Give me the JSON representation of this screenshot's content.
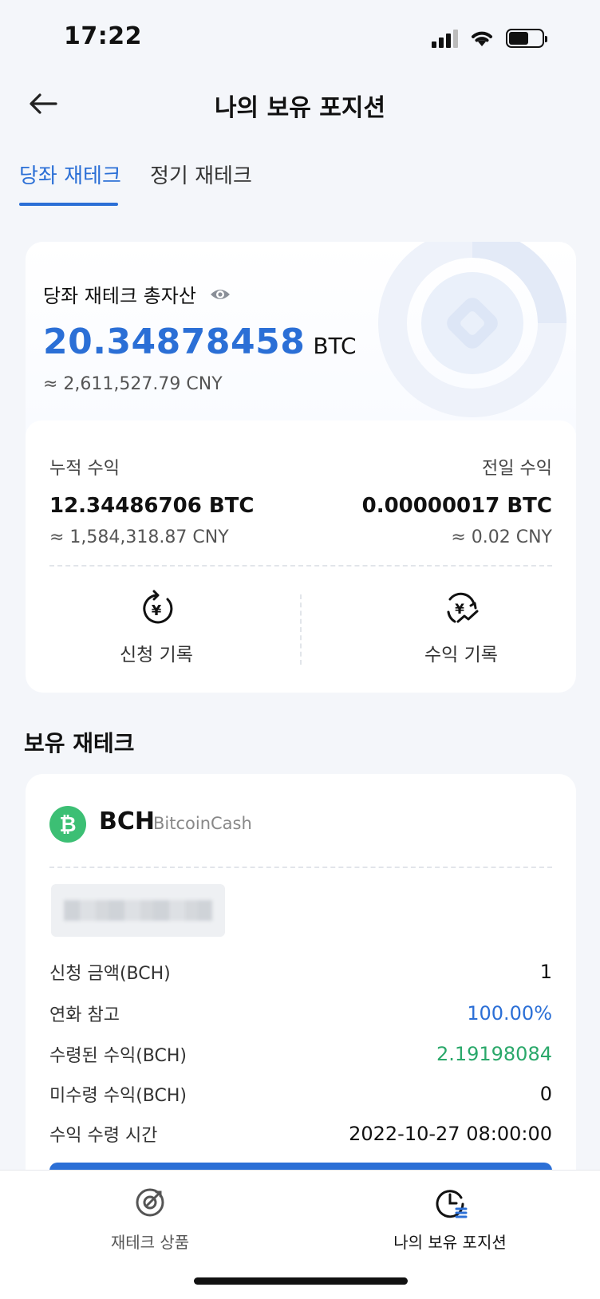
{
  "status_bar": {
    "time": "17:22"
  },
  "header": {
    "title": "나의 보유 포지션"
  },
  "tabs": [
    {
      "label": "당좌 재테크",
      "active": true
    },
    {
      "label": "정기 재테크",
      "active": false
    }
  ],
  "summary": {
    "label": "당좌 재테크 총자산",
    "total_value": "20.34878458",
    "total_unit": "BTC",
    "total_cny": "≈ 2,611,527.79 CNY",
    "cumulative": {
      "label": "누적 수익",
      "value": "12.34486706 BTC",
      "cny": "≈ 1,584,318.87 CNY"
    },
    "previous_day": {
      "label": "전일 수익",
      "value": "0.00000017 BTC",
      "cny": "≈ 0.02 CNY"
    },
    "actions": [
      {
        "label": "신청 기록",
        "icon": "yen-refresh-icon"
      },
      {
        "label": "수익 기록",
        "icon": "yen-trend-icon"
      }
    ]
  },
  "holdings": {
    "title": "보유 재테크",
    "items": [
      {
        "symbol": "BCH",
        "name": "BitcoinCash",
        "icon": "bitcoin-cash-icon",
        "rows": [
          {
            "key": "신청 금액(BCH)",
            "value": "1",
            "tone": "default"
          },
          {
            "key": "연화 참고",
            "value": "100.00%",
            "tone": "blue"
          },
          {
            "key": "수령된 수익(BCH)",
            "value": "2.19198084",
            "tone": "green"
          },
          {
            "key": "미수령 수익(BCH)",
            "value": "0",
            "tone": "default"
          },
          {
            "key": "수익 수령 시간",
            "value": "2022-10-27 08:00:00",
            "tone": "default"
          }
        ]
      }
    ]
  },
  "bottom_nav": [
    {
      "label": "재테크 상품",
      "icon": "products-icon",
      "active": false
    },
    {
      "label": "나의 보유 포지션",
      "icon": "positions-icon",
      "active": true
    }
  ],
  "colors": {
    "accent": "#2b6fd6",
    "green": "#2aa86a",
    "coin": "#3cbf74"
  }
}
